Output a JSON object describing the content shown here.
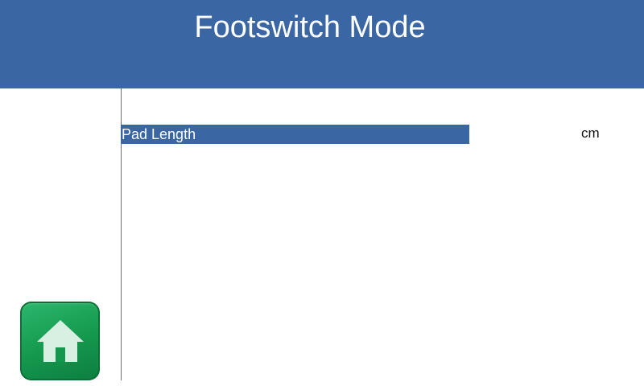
{
  "header": {
    "title": "Footswitch Mode",
    "background_color": "#3a66a4"
  },
  "field": {
    "label": "Pad Length",
    "unit": "cm",
    "bar_color": "#3a66a4"
  },
  "home_button": {
    "icon": "home-icon",
    "color": "#14984e"
  }
}
